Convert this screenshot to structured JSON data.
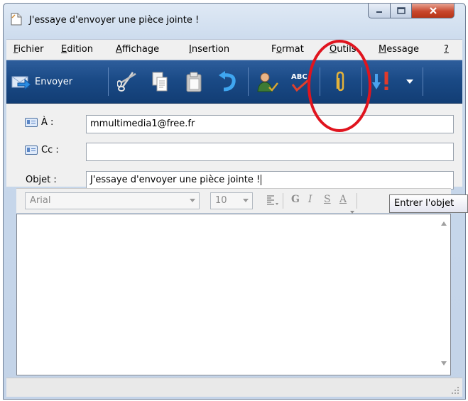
{
  "window": {
    "title": "J'essaye d'envoyer une pièce jointe !"
  },
  "menu": [
    {
      "label": "Fichier",
      "hotkey": "F",
      "rest": "ichier"
    },
    {
      "label": "Edition",
      "hotkey": "E",
      "rest": "dition"
    },
    {
      "label": "Affichage",
      "hotkey": "A",
      "rest": "ffichage"
    },
    {
      "label": "Insertion",
      "hotkey": "I",
      "rest": "nsertion"
    },
    {
      "label": "Format",
      "pre": "F",
      "hotkey": "o",
      "rest": "rmat"
    },
    {
      "label": "Outils",
      "hotkey": "O",
      "rest": "utils"
    },
    {
      "label": "Message",
      "hotkey": "M",
      "rest": "essage"
    },
    {
      "label": "?",
      "hotkey": "?",
      "rest": ""
    }
  ],
  "toolbar": {
    "send_label": "Envoyer",
    "icons": [
      "send-icon",
      "cut-icon",
      "copy-icon",
      "paste-icon",
      "undo-icon",
      "check-names-icon",
      "spelling-icon",
      "attach-icon",
      "priority-icon",
      "dropdown-icon"
    ]
  },
  "header": {
    "to_label": "À :",
    "to_value": "mmultimedia1@free.fr",
    "cc_label": "Cc :",
    "cc_value": "",
    "subject_label": "Objet :",
    "subject_value": "J'essaye d'envoyer une pièce jointe !"
  },
  "format": {
    "font": "Arial",
    "size": "10",
    "bold": "G",
    "italic": "I",
    "underline": "S",
    "color": "A"
  },
  "tooltip": "Entrer l'objet",
  "annotation": {
    "color": "#e0141e"
  }
}
